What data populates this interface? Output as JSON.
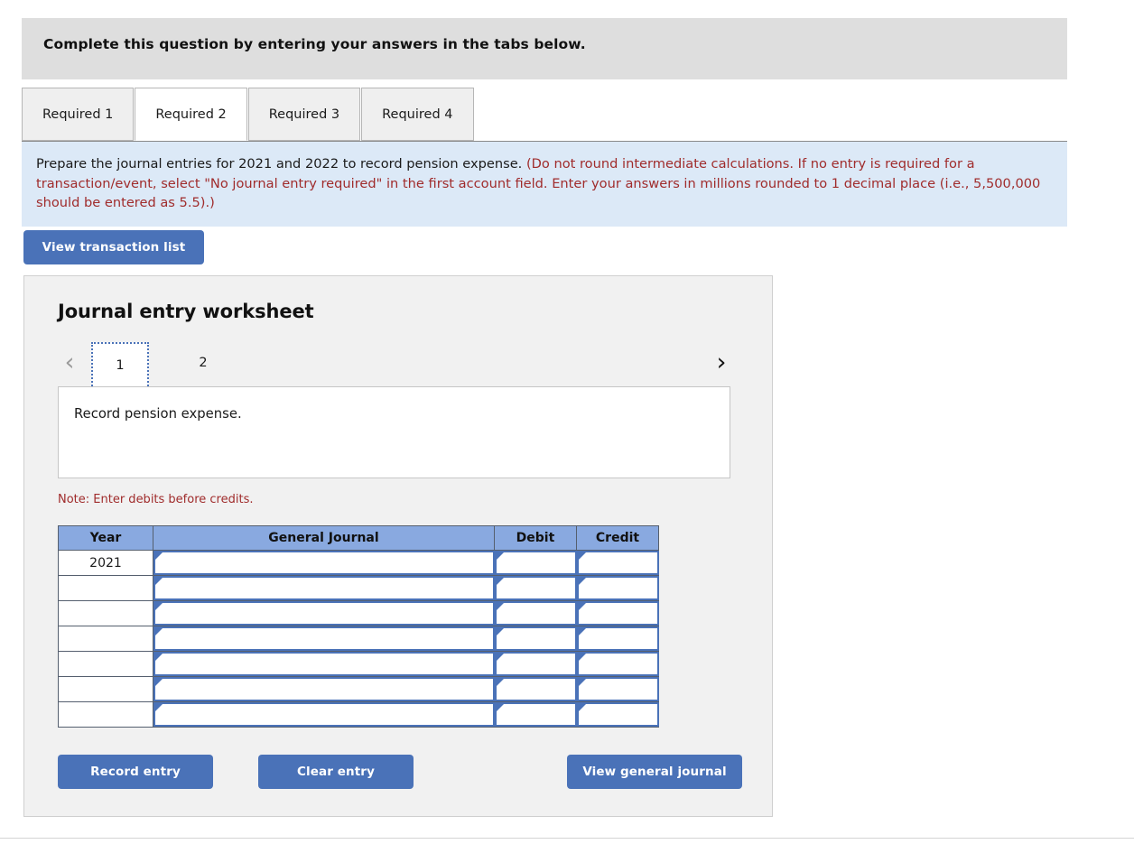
{
  "banner": {
    "text": "Complete this question by entering your answers in the tabs below."
  },
  "tabs": [
    {
      "label": "Required 1",
      "active": false
    },
    {
      "label": "Required 2",
      "active": true
    },
    {
      "label": "Required 3",
      "active": false
    },
    {
      "label": "Required 4",
      "active": false
    }
  ],
  "instructions": {
    "main": "Prepare the journal entries for 2021 and 2022 to record pension expense.",
    "hint": "(Do not round intermediate calculations. If no entry is required for a transaction/event, select \"No journal entry required\" in the first account field. Enter your answers in millions rounded to 1 decimal place (i.e., 5,500,000 should be entered as 5.5).)"
  },
  "toolbar": {
    "view_transaction_list_label": "View transaction list"
  },
  "worksheet": {
    "title": "Journal entry worksheet",
    "pager": {
      "prev_icon": "chevron-left-icon",
      "next_icon": "chevron-right-icon",
      "pages": [
        {
          "label": "1",
          "active": true
        },
        {
          "label": "2",
          "active": false
        }
      ]
    },
    "description": "Record pension expense.",
    "note": "Note: Enter debits before credits.",
    "table": {
      "columns": [
        "Year",
        "General Journal",
        "Debit",
        "Credit"
      ],
      "rows": [
        {
          "year": "2021",
          "journal": "",
          "debit": "",
          "credit": ""
        },
        {
          "year": "",
          "journal": "",
          "debit": "",
          "credit": ""
        },
        {
          "year": "",
          "journal": "",
          "debit": "",
          "credit": ""
        },
        {
          "year": "",
          "journal": "",
          "debit": "",
          "credit": ""
        },
        {
          "year": "",
          "journal": "",
          "debit": "",
          "credit": ""
        },
        {
          "year": "",
          "journal": "",
          "debit": "",
          "credit": ""
        },
        {
          "year": "",
          "journal": "",
          "debit": "",
          "credit": ""
        }
      ]
    },
    "buttons": {
      "record_entry": "Record entry",
      "clear_entry": "Clear entry",
      "view_general_journal": "View general journal"
    }
  },
  "colors": {
    "button_blue": "#4a72b8",
    "table_header_blue": "#89a9e0",
    "banner_gray": "#dedede",
    "instruction_blue": "#dce9f7",
    "hint_red": "#a02c2c",
    "panel_gray": "#f1f1f1"
  }
}
